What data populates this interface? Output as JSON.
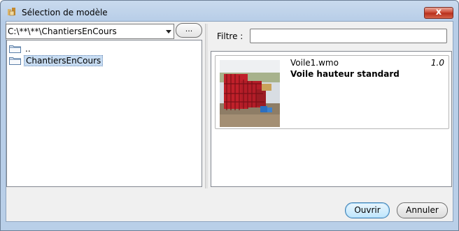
{
  "window": {
    "title": "Sélection de modèle",
    "close_label": "x"
  },
  "left_pane": {
    "path_value": "C:\\**\\**\\ChantiersEnCours",
    "browse_label": "...",
    "tree": [
      {
        "label": "..",
        "selected": false
      },
      {
        "label": "ChantiersEnCours",
        "selected": true
      }
    ]
  },
  "right_pane": {
    "filter_label": "Filtre :",
    "filter_value": "",
    "models": [
      {
        "file": "Voile1.wmo",
        "version": "1.0",
        "title": "Voile hauteur standard",
        "thumbnail": "construction-site-photo"
      }
    ]
  },
  "buttons": {
    "ok": "Ouvrir",
    "cancel": "Annuler"
  },
  "colors": {
    "titlebar": "#b9cfe8",
    "close": "#c9412c",
    "selection": "#c7dcf2"
  }
}
